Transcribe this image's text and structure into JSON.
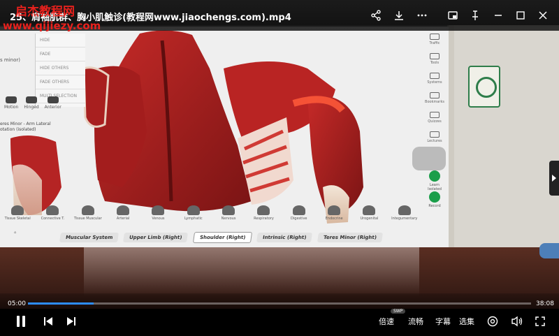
{
  "titlebar": {
    "title": "25、肩袖肌群、胸小肌触诊(教程网www.jiaochengs.com).mp4",
    "watermark_cn": "启杰教程网",
    "watermark_url": "www.qijiezy.com",
    "icons": [
      "share-icon",
      "download-icon",
      "more-icon",
      "pip-icon",
      "pin-icon",
      "minimize-icon",
      "maximize-icon",
      "close-icon"
    ]
  },
  "app": {
    "menu_items": [
      "HIDE",
      "FADE",
      "HIDE OTHERS",
      "FADE OTHERS",
      "MULTI SELECTION"
    ],
    "minor_label": "s minor)",
    "left_tools": [
      "Motion",
      "Hinged",
      "Anterior"
    ],
    "info_line1": "eres Minor - Arm Lateral",
    "info_line2": "otation (isolated)",
    "right_tools": [
      "Traffic",
      "Tools",
      "Systems",
      "Bookmarks",
      "Quizzes",
      "Lectures"
    ],
    "green_labels": [
      "Learn Isolated",
      "Record"
    ],
    "bottom_tools": [
      "Tissue Skeletal",
      "Connective T.",
      "Tissue Muscular",
      "Arterial",
      "Venous",
      "Lymphatic",
      "Nervous",
      "Respiratory",
      "Digestive",
      "Endocrine",
      "Urogenital",
      "Integumentary"
    ],
    "breadcrumbs": [
      "Muscular System",
      "Upper Limb (Right)",
      "Shoulder (Right)",
      "Intrinsic (Right)",
      "Teres Minor (Right)"
    ],
    "active_breadcrumb": 2
  },
  "player": {
    "current_time": "05:00",
    "total_time": "38:08",
    "progress": 0.131,
    "speed_label": "倍速",
    "swp_badge": "SWP",
    "quality_label": "流畅",
    "subtitle_label": "字幕",
    "episodes_label": "选集",
    "accent": "#2d8cff",
    "icons": [
      "pause-icon",
      "previous-icon",
      "next-icon",
      "danmaku-icon",
      "volume-icon",
      "fullscreen-icon"
    ]
  }
}
